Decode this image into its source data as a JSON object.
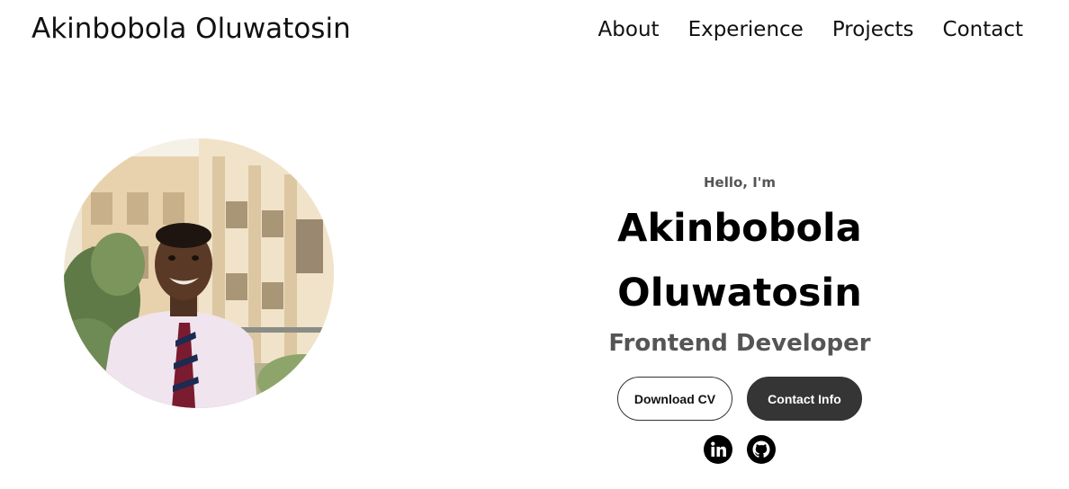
{
  "header": {
    "logo": "Akinbobola Oluwatosin",
    "nav": [
      "About",
      "Experience",
      "Projects",
      "Contact"
    ]
  },
  "hero": {
    "greeting": "Hello, I'm",
    "name_line1": "Akinbobola",
    "name_line2": "Oluwatosin",
    "role": "Frontend Developer",
    "download_cv_label": "Download CV",
    "contact_info_label": "Contact Info"
  },
  "socials": {
    "icons": [
      "linkedin-icon",
      "github-icon"
    ]
  },
  "colors": {
    "text": "#111111",
    "muted": "#555555",
    "button_dark": "#353535"
  }
}
